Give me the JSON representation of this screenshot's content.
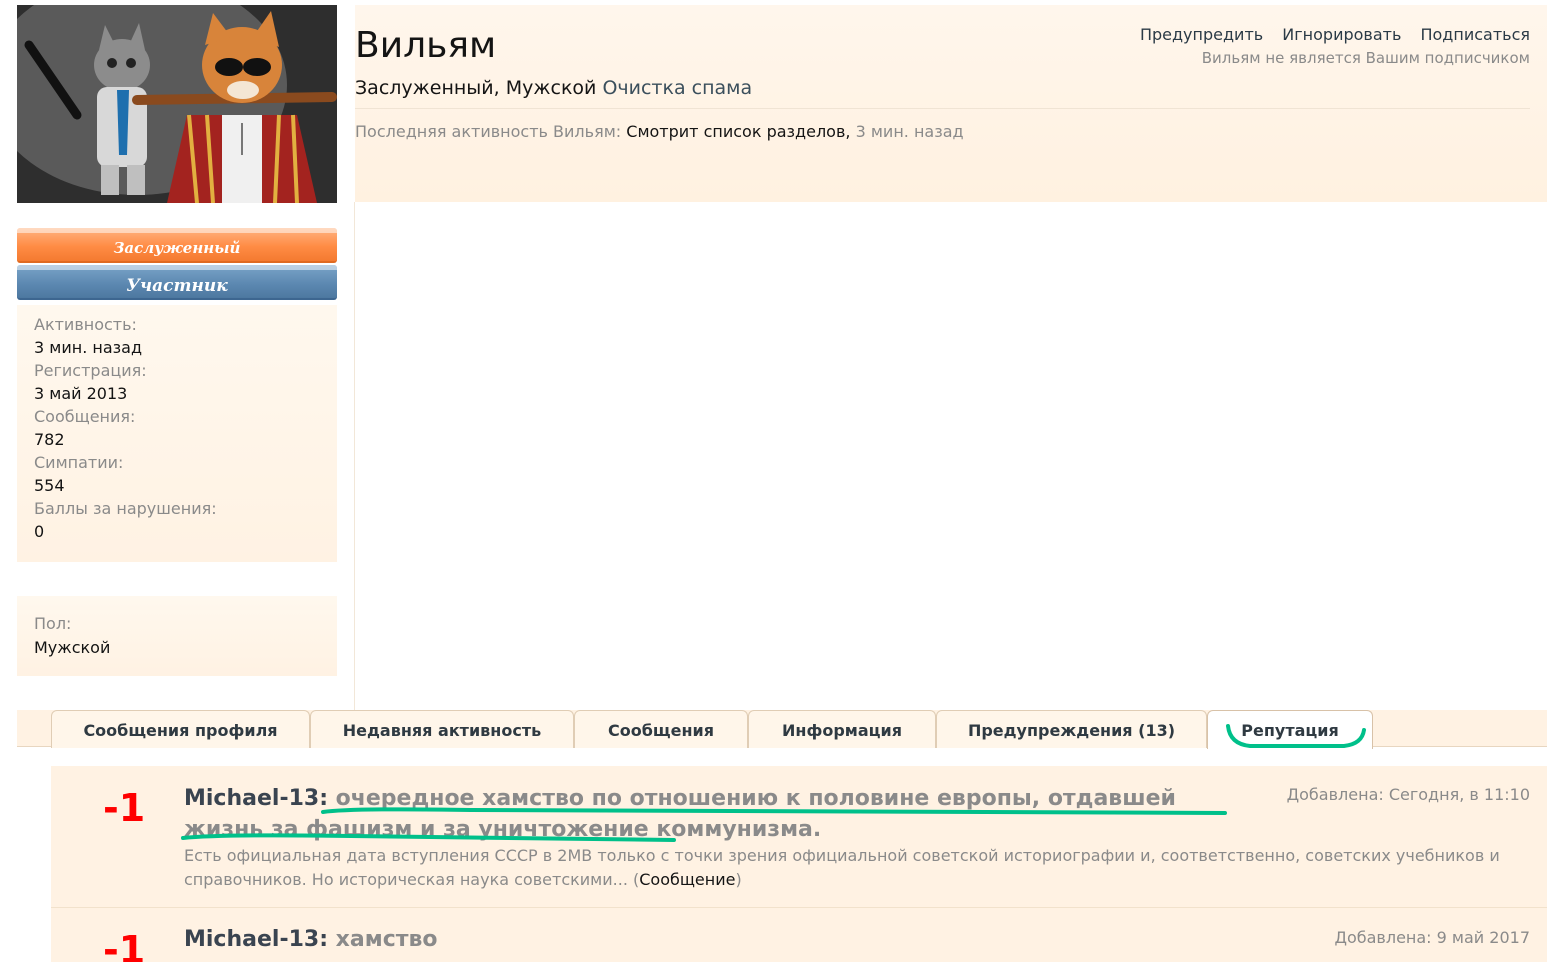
{
  "profile": {
    "username": "Вильям",
    "title_line": "Заслуженный, Мужской",
    "title_extra": "Очистка спама",
    "actions": [
      "Предупредить",
      "Игнорировать",
      "Подписаться"
    ],
    "follow_note": "Вильям не является Вашим подписчиком",
    "last_activity_label": "Последняя активность Вильям:",
    "last_activity_action": "Смотрит список разделов,",
    "last_activity_time": "3 мин. назад"
  },
  "banners": {
    "orange": "Заслуженный",
    "blue": "Участник"
  },
  "stats": [
    {
      "label": "Активность:",
      "value": "3 мин. назад"
    },
    {
      "label": "Регистрация:",
      "value": "3 май 2013"
    },
    {
      "label": "Сообщения:",
      "value": "782"
    },
    {
      "label": "Симпатии:",
      "value": "554"
    },
    {
      "label": "Баллы за нарушения:",
      "value": "0"
    }
  ],
  "gender": {
    "label": "Пол:",
    "value": "Мужской"
  },
  "tabs": [
    {
      "label": "Сообщения профиля",
      "active": false
    },
    {
      "label": "Недавняя активность",
      "active": false
    },
    {
      "label": "Сообщения",
      "active": false
    },
    {
      "label": "Информация",
      "active": false
    },
    {
      "label": "Предупреждения (13)",
      "active": false
    },
    {
      "label": "Репутация",
      "active": true
    }
  ],
  "reputation": [
    {
      "score": "-1",
      "author": "Michael-13:",
      "reason": "очередное хамство по отношению к половине европы, отдавшей жизнь за фашизм и за уничтожение коммунизма.",
      "date": "Добавлена: Сегодня, в 11:10",
      "snippet": "Есть официальная дата вступления СССР в 2МВ только с точки зрения официальной советской историографии и, соответственно, советских учебников и справочников. Но историческая наука советскими... (",
      "snippet_link": "Сообщение",
      "snippet_end": ")"
    },
    {
      "score": "-1",
      "author": "Michael-13:",
      "reason": "хамство",
      "date": "Добавлена: 9 май 2017"
    }
  ],
  "colors": {
    "panel_bg": "#fff2e3",
    "score_red": "#ff0000",
    "annotation_green": "#00c08a",
    "banner_orange": "#ff8c45",
    "banner_blue": "#5b87b0"
  }
}
